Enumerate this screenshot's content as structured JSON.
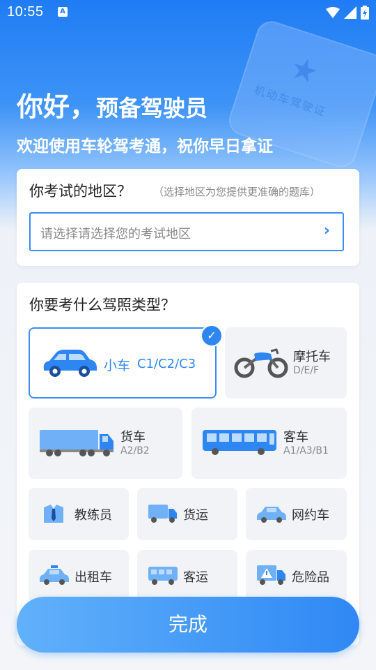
{
  "status_bar": {
    "time": "10:55"
  },
  "greeting": {
    "title_main": "你好，",
    "title_rest": "预备驾驶员",
    "subtitle": "欢迎使用车轮驾考通，祝你早日拿证"
  },
  "license_card_text": "机动车驾驶证",
  "region": {
    "title": "你考试的地区？",
    "hint": "（选择地区为您提供更准确的题库）",
    "placeholder": "请选择请选择您的考试地区"
  },
  "license_types": {
    "title": "你要考什么驾照类型？",
    "large": [
      {
        "label": "小车",
        "code": "C1/C2/C3",
        "selected": true
      },
      {
        "label": "摩托车",
        "code": "D/E/F",
        "selected": false
      },
      {
        "label": "货车",
        "code": "A2/B2",
        "selected": false
      },
      {
        "label": "客车",
        "code": "A1/A3/B1",
        "selected": false
      }
    ],
    "small": [
      {
        "label": "教练员"
      },
      {
        "label": "货运"
      },
      {
        "label": "网约车"
      },
      {
        "label": "出租车"
      },
      {
        "label": "客运"
      },
      {
        "label": "危险品"
      }
    ]
  },
  "done_button": "完成",
  "colors": {
    "accent": "#2e86f3",
    "selected_border": "#3a8ef5"
  }
}
